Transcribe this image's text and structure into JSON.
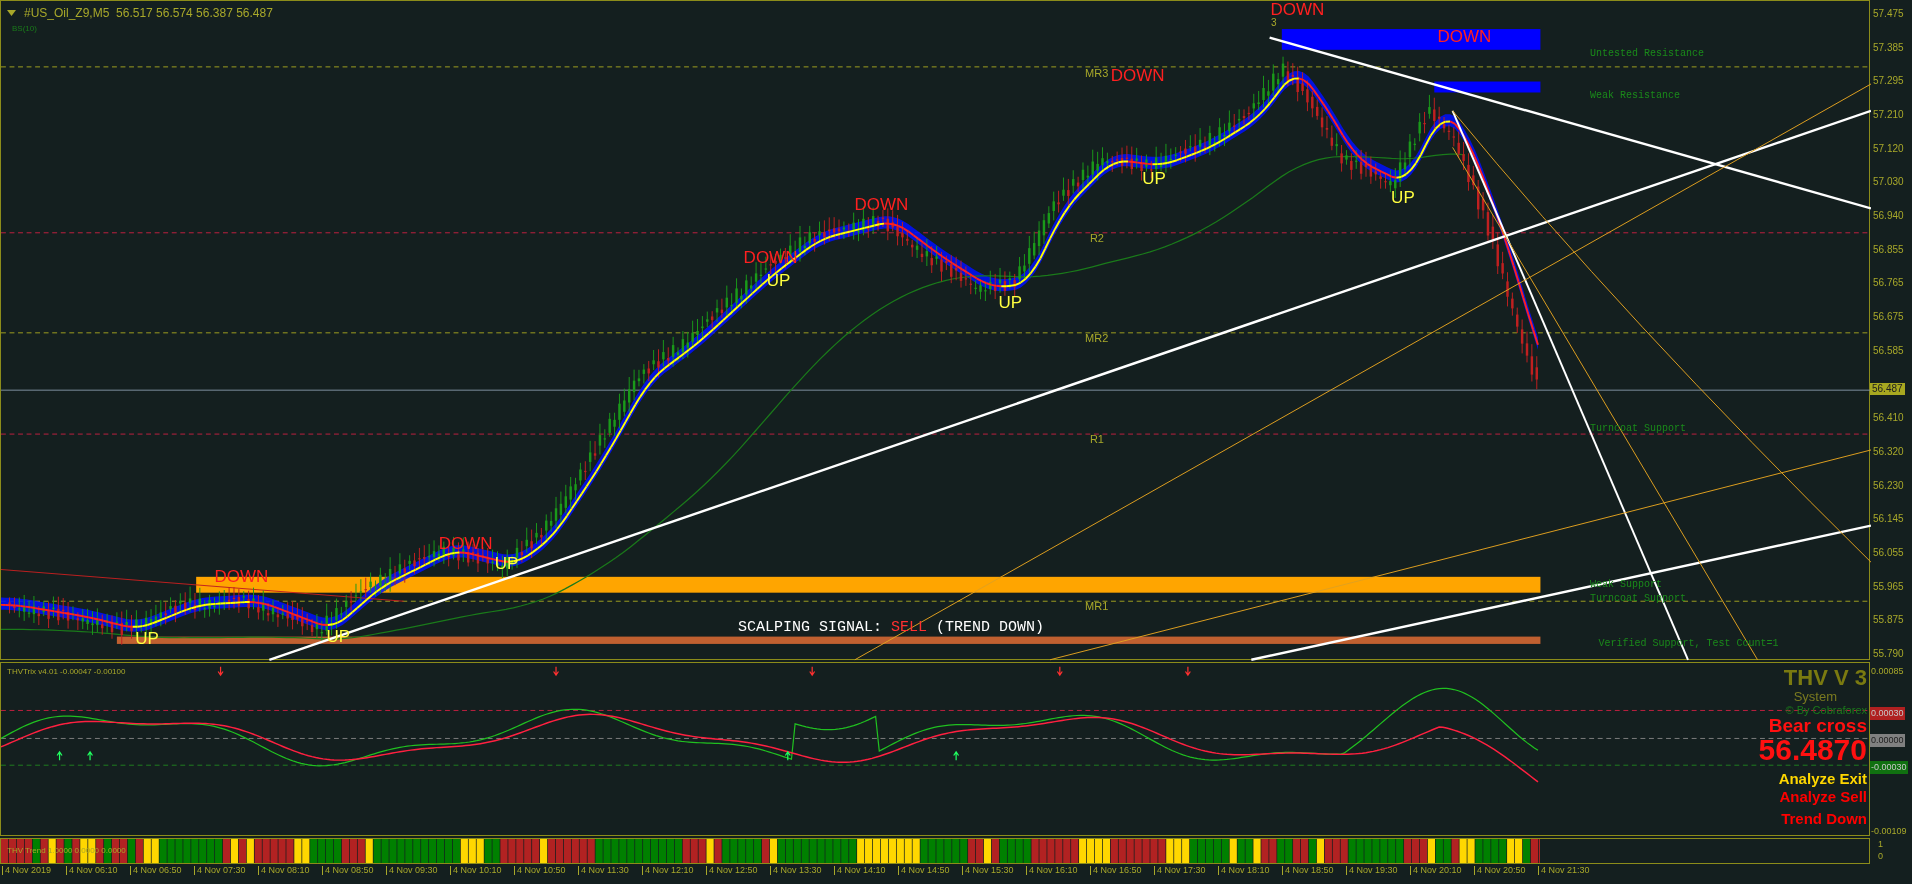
{
  "window": {
    "title": "#US_Oil_Z9,M5  56.517 56.574 56.387 56.487"
  },
  "main_chart": {
    "indicator_label": "BS(10)",
    "wave_count": "3",
    "signals": [
      {
        "kind": "down",
        "text": "DOWN"
      },
      {
        "kind": "down",
        "text": "DOWN"
      },
      {
        "kind": "down",
        "text": "DOWN"
      },
      {
        "kind": "down",
        "text": "DOWN"
      },
      {
        "kind": "down",
        "text": "DOWN"
      },
      {
        "kind": "up",
        "text": "UP"
      },
      {
        "kind": "up",
        "text": "UP"
      },
      {
        "kind": "up",
        "text": "UP"
      },
      {
        "kind": "up",
        "text": "UP"
      },
      {
        "kind": "down",
        "text": "DOWN"
      },
      {
        "kind": "up",
        "text": "UP"
      },
      {
        "kind": "down",
        "text": "DOWN"
      },
      {
        "kind": "up",
        "text": "UP"
      },
      {
        "kind": "up",
        "text": "UP"
      }
    ],
    "pivot_labels": [
      "MR3",
      "R2",
      "MR2",
      "R1",
      "MR1"
    ],
    "zone_labels": [
      "Untested Resistance",
      "Weak Resistance",
      "Turncoat Support",
      "Weak Support",
      "Turncoat Support",
      "Verified Support, Test Count=1"
    ],
    "banner": {
      "prefix": "SCALPING SIGNAL:",
      "signal": "SELL",
      "suffix": "(TREND DOWN)"
    },
    "price_axis": [
      "57.475",
      "57.385",
      "57.295",
      "57.210",
      "57.120",
      "57.030",
      "56.940",
      "56.855",
      "56.765",
      "56.675",
      "56.585",
      "56.410",
      "56.320",
      "56.230",
      "56.145",
      "56.055",
      "55.965",
      "55.875",
      "55.790"
    ],
    "current_price": "56.487"
  },
  "oscillator": {
    "label": "THVTrix v4.01 -0.00047 -0.00100",
    "axis": [
      {
        "kind": "plain",
        "text": "0.00085"
      },
      {
        "kind": "upper",
        "text": "0.00030"
      },
      {
        "kind": "zero",
        "text": "0.00000"
      },
      {
        "kind": "lower",
        "text": "-0.00030"
      },
      {
        "kind": "plain",
        "text": "-0.00109"
      }
    ],
    "title": "THV V 3",
    "subtitle": "System",
    "credit": "© By Cobraforex",
    "cross": "Bear cross",
    "price": "56.4870",
    "status_lines": [
      {
        "text": "Analyze Exit",
        "color": "#ffd700"
      },
      {
        "text": "Analyze Sell",
        "color": "#ff0000"
      },
      {
        "text": "Trend Down",
        "color": "#ff0000"
      }
    ]
  },
  "trend_bar": {
    "label": "THV Trend 1.0000 0.0000 0.0000",
    "axis": [
      "1",
      "0"
    ]
  },
  "time_axis": [
    "4 Nov 2019",
    "4 Nov 06:10",
    "4 Nov 06:50",
    "4 Nov 07:30",
    "4 Nov 08:10",
    "4 Nov 08:50",
    "4 Nov 09:30",
    "4 Nov 10:10",
    "4 Nov 10:50",
    "4 Nov 11:30",
    "4 Nov 12:10",
    "4 Nov 12:50",
    "4 Nov 13:30",
    "4 Nov 14:10",
    "4 Nov 14:50",
    "4 Nov 15:30",
    "4 Nov 16:10",
    "4 Nov 16:50",
    "4 Nov 17:30",
    "4 Nov 18:10",
    "4 Nov 18:50",
    "4 Nov 19:30",
    "4 Nov 20:10",
    "4 Nov 20:50",
    "4 Nov 21:30"
  ]
}
